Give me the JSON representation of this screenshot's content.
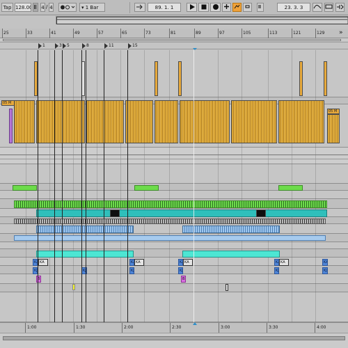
{
  "transport": {
    "tap_label": "Tap",
    "tempo": "128.00",
    "time_sig_num": "4",
    "time_sig_sep": "/",
    "time_sig_den": "4",
    "metronome_icon": "metronome-icon",
    "quantize": "1 Bar",
    "arrangement_position": "89.  1.  1",
    "play_icon": "play-icon",
    "stop_icon": "stop-icon",
    "record_icon": "record-icon",
    "overdub_icon": "plus-icon",
    "automation_icon": "automation-arm-icon",
    "loop_start": "23.  3.  3",
    "colors": {
      "accent": "#f0a23a",
      "playhead": "#2e8fc9"
    }
  },
  "ruler": {
    "bars": [
      "25",
      "33",
      "41",
      "49",
      "57",
      "65",
      "73",
      "81",
      "89",
      "97",
      "105",
      "113",
      "121",
      "129"
    ],
    "scroll_right_label": "»"
  },
  "locators": [
    "1",
    "3",
    "5",
    "8",
    "11",
    "15"
  ],
  "clip_labels": {
    "master_a": "05 M",
    "master_b": "05 M",
    "ka": "KA",
    "kj": "KJ",
    "b": "B"
  },
  "time_ruler": [
    "1:00",
    "1:30",
    "2:00",
    "2:30",
    "3:00",
    "3:30",
    "4:00"
  ]
}
